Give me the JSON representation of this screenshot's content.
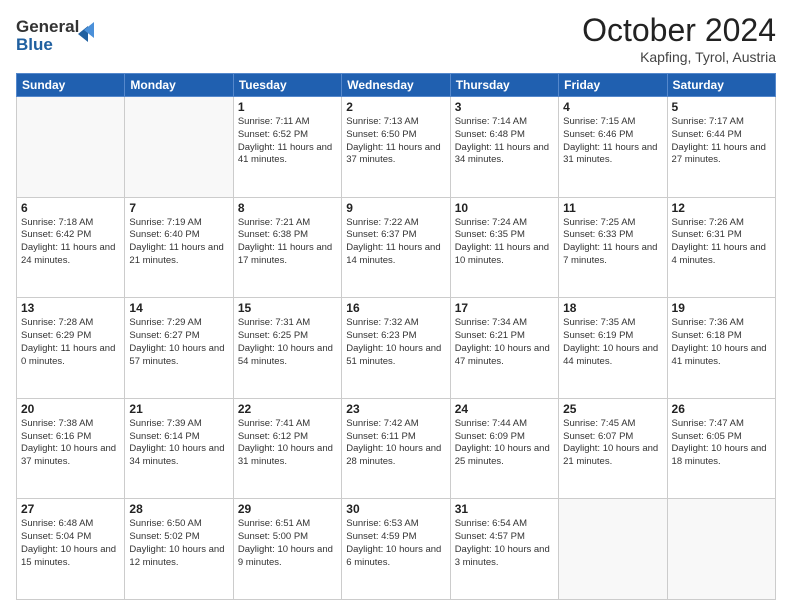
{
  "header": {
    "logo_general": "General",
    "logo_blue": "Blue",
    "month_title": "October 2024",
    "subtitle": "Kapfing, Tyrol, Austria"
  },
  "weekdays": [
    "Sunday",
    "Monday",
    "Tuesday",
    "Wednesday",
    "Thursday",
    "Friday",
    "Saturday"
  ],
  "weeks": [
    [
      {
        "day": "",
        "info": ""
      },
      {
        "day": "",
        "info": ""
      },
      {
        "day": "1",
        "info": "Sunrise: 7:11 AM\nSunset: 6:52 PM\nDaylight: 11 hours and 41 minutes."
      },
      {
        "day": "2",
        "info": "Sunrise: 7:13 AM\nSunset: 6:50 PM\nDaylight: 11 hours and 37 minutes."
      },
      {
        "day": "3",
        "info": "Sunrise: 7:14 AM\nSunset: 6:48 PM\nDaylight: 11 hours and 34 minutes."
      },
      {
        "day": "4",
        "info": "Sunrise: 7:15 AM\nSunset: 6:46 PM\nDaylight: 11 hours and 31 minutes."
      },
      {
        "day": "5",
        "info": "Sunrise: 7:17 AM\nSunset: 6:44 PM\nDaylight: 11 hours and 27 minutes."
      }
    ],
    [
      {
        "day": "6",
        "info": "Sunrise: 7:18 AM\nSunset: 6:42 PM\nDaylight: 11 hours and 24 minutes."
      },
      {
        "day": "7",
        "info": "Sunrise: 7:19 AM\nSunset: 6:40 PM\nDaylight: 11 hours and 21 minutes."
      },
      {
        "day": "8",
        "info": "Sunrise: 7:21 AM\nSunset: 6:38 PM\nDaylight: 11 hours and 17 minutes."
      },
      {
        "day": "9",
        "info": "Sunrise: 7:22 AM\nSunset: 6:37 PM\nDaylight: 11 hours and 14 minutes."
      },
      {
        "day": "10",
        "info": "Sunrise: 7:24 AM\nSunset: 6:35 PM\nDaylight: 11 hours and 10 minutes."
      },
      {
        "day": "11",
        "info": "Sunrise: 7:25 AM\nSunset: 6:33 PM\nDaylight: 11 hours and 7 minutes."
      },
      {
        "day": "12",
        "info": "Sunrise: 7:26 AM\nSunset: 6:31 PM\nDaylight: 11 hours and 4 minutes."
      }
    ],
    [
      {
        "day": "13",
        "info": "Sunrise: 7:28 AM\nSunset: 6:29 PM\nDaylight: 11 hours and 0 minutes."
      },
      {
        "day": "14",
        "info": "Sunrise: 7:29 AM\nSunset: 6:27 PM\nDaylight: 10 hours and 57 minutes."
      },
      {
        "day": "15",
        "info": "Sunrise: 7:31 AM\nSunset: 6:25 PM\nDaylight: 10 hours and 54 minutes."
      },
      {
        "day": "16",
        "info": "Sunrise: 7:32 AM\nSunset: 6:23 PM\nDaylight: 10 hours and 51 minutes."
      },
      {
        "day": "17",
        "info": "Sunrise: 7:34 AM\nSunset: 6:21 PM\nDaylight: 10 hours and 47 minutes."
      },
      {
        "day": "18",
        "info": "Sunrise: 7:35 AM\nSunset: 6:19 PM\nDaylight: 10 hours and 44 minutes."
      },
      {
        "day": "19",
        "info": "Sunrise: 7:36 AM\nSunset: 6:18 PM\nDaylight: 10 hours and 41 minutes."
      }
    ],
    [
      {
        "day": "20",
        "info": "Sunrise: 7:38 AM\nSunset: 6:16 PM\nDaylight: 10 hours and 37 minutes."
      },
      {
        "day": "21",
        "info": "Sunrise: 7:39 AM\nSunset: 6:14 PM\nDaylight: 10 hours and 34 minutes."
      },
      {
        "day": "22",
        "info": "Sunrise: 7:41 AM\nSunset: 6:12 PM\nDaylight: 10 hours and 31 minutes."
      },
      {
        "day": "23",
        "info": "Sunrise: 7:42 AM\nSunset: 6:11 PM\nDaylight: 10 hours and 28 minutes."
      },
      {
        "day": "24",
        "info": "Sunrise: 7:44 AM\nSunset: 6:09 PM\nDaylight: 10 hours and 25 minutes."
      },
      {
        "day": "25",
        "info": "Sunrise: 7:45 AM\nSunset: 6:07 PM\nDaylight: 10 hours and 21 minutes."
      },
      {
        "day": "26",
        "info": "Sunrise: 7:47 AM\nSunset: 6:05 PM\nDaylight: 10 hours and 18 minutes."
      }
    ],
    [
      {
        "day": "27",
        "info": "Sunrise: 6:48 AM\nSunset: 5:04 PM\nDaylight: 10 hours and 15 minutes."
      },
      {
        "day": "28",
        "info": "Sunrise: 6:50 AM\nSunset: 5:02 PM\nDaylight: 10 hours and 12 minutes."
      },
      {
        "day": "29",
        "info": "Sunrise: 6:51 AM\nSunset: 5:00 PM\nDaylight: 10 hours and 9 minutes."
      },
      {
        "day": "30",
        "info": "Sunrise: 6:53 AM\nSunset: 4:59 PM\nDaylight: 10 hours and 6 minutes."
      },
      {
        "day": "31",
        "info": "Sunrise: 6:54 AM\nSunset: 4:57 PM\nDaylight: 10 hours and 3 minutes."
      },
      {
        "day": "",
        "info": ""
      },
      {
        "day": "",
        "info": ""
      }
    ]
  ]
}
